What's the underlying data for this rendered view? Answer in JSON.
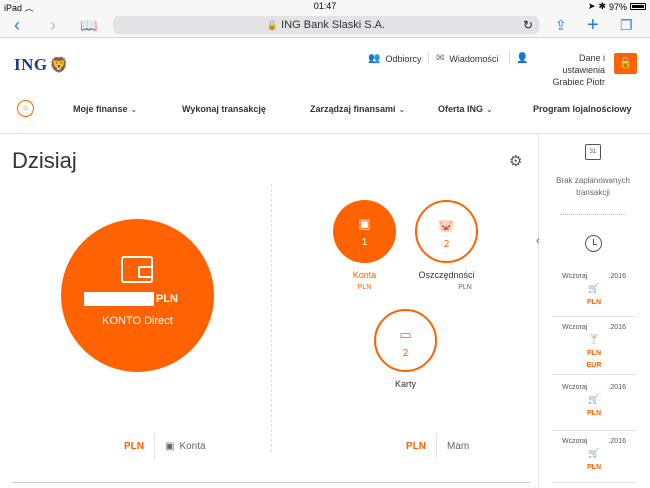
{
  "status_bar": {
    "device": "iPad",
    "wifi_icon": "wifi-icon",
    "time": "01:47",
    "battery": "97%"
  },
  "browser": {
    "url": "ING Bank Slaski S.A."
  },
  "header": {
    "logo_text": "ING",
    "odbiorcy": "Odbiorcy",
    "wiadomosci": "Wiadomości",
    "settings": "Dane i ustawienia",
    "user_name": "Grabiec Piotr"
  },
  "nav": {
    "items": [
      {
        "label": "Moje finanse",
        "chevron": true
      },
      {
        "label": "Wykonaj transakcję",
        "chevron": false
      },
      {
        "label": "Zarządzaj finansami",
        "chevron": true
      },
      {
        "label": "Oferta ING",
        "chevron": true
      },
      {
        "label": "Program lojalnościowy",
        "chevron": false
      }
    ]
  },
  "main": {
    "title": "Dzisiaj",
    "account": {
      "currency": "PLN",
      "name": "KONTO Direct"
    },
    "products": {
      "konta": {
        "count": "1",
        "label": "Konta",
        "currency": "PLN"
      },
      "oszczednosci": {
        "count": "2",
        "label": "Oszczędności",
        "currency": "PLN"
      },
      "karty": {
        "count": "2",
        "label": "Karty"
      }
    },
    "bottom_left": {
      "currency": "PLN",
      "label": "Konta"
    },
    "bottom_right": {
      "currency": "PLN",
      "label": "Mam"
    }
  },
  "sidebar": {
    "calendar_day": "31",
    "no_planned": "Brak zaplanowanych transakcji",
    "transactions": [
      {
        "date": "Wczoraj",
        "year": ".2016",
        "icon": "cart-icon",
        "currencies": [
          "PLN"
        ]
      },
      {
        "date": "Wczoraj",
        "year": ".2016",
        "icon": "cocktail-icon",
        "currencies": [
          "PLN",
          "EUR"
        ]
      },
      {
        "date": "Wczoraj",
        "year": ".2016",
        "icon": "cart-icon",
        "currencies": [
          "PLN"
        ]
      },
      {
        "date": "Wczoraj",
        "year": ".2016",
        "icon": "cart-icon",
        "currencies": [
          "PLN"
        ]
      }
    ]
  },
  "colors": {
    "accent": "#ff6200",
    "brand_blue": "#1f3b8c",
    "link_blue": "#1a7cf5"
  }
}
